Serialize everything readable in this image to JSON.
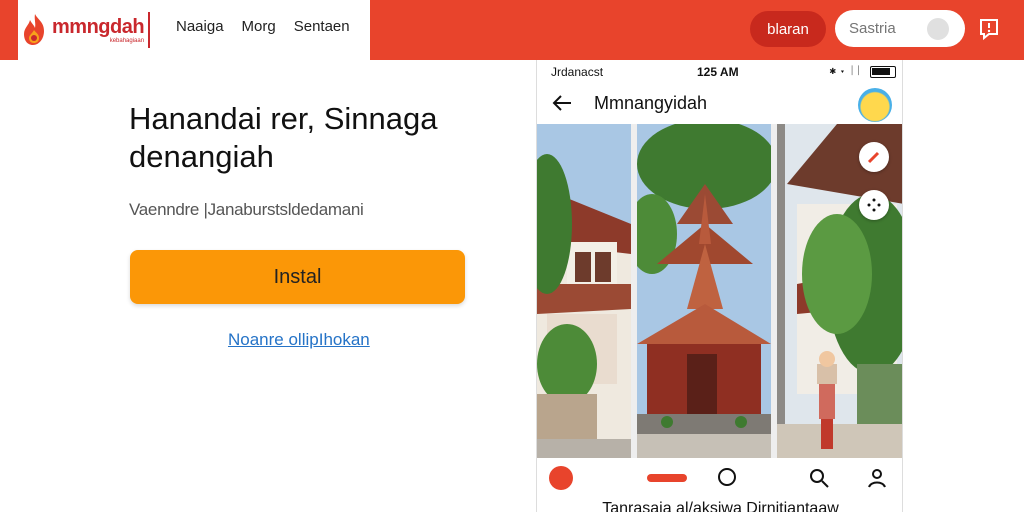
{
  "brand": {
    "name": "mmngdah",
    "tagline": "kebahagiaan"
  },
  "nav": {
    "items": [
      "Naaiga",
      "Morg",
      "Sentaen"
    ]
  },
  "header": {
    "button_label": "blaran",
    "search_placeholder": "Sastria"
  },
  "hero": {
    "title": "Hanandai rer, Sinnaga denangiah",
    "subtitle": "Vaenndre |Janaburstsldedamani",
    "install_label": "Instal",
    "link_label": "Noanre ollipIhokan"
  },
  "phone": {
    "status": {
      "carrier": "Jrdanacst",
      "time": "125 AM",
      "icons": "✱ ▾ ᛁᛁ"
    },
    "app_title": "Mmnangyidah",
    "caption": "Tanrasaia al/aksiwa Dirnitiantaaw"
  },
  "colors": {
    "accent": "#e8442c",
    "button": "#fb9707",
    "link": "#2573c7"
  }
}
